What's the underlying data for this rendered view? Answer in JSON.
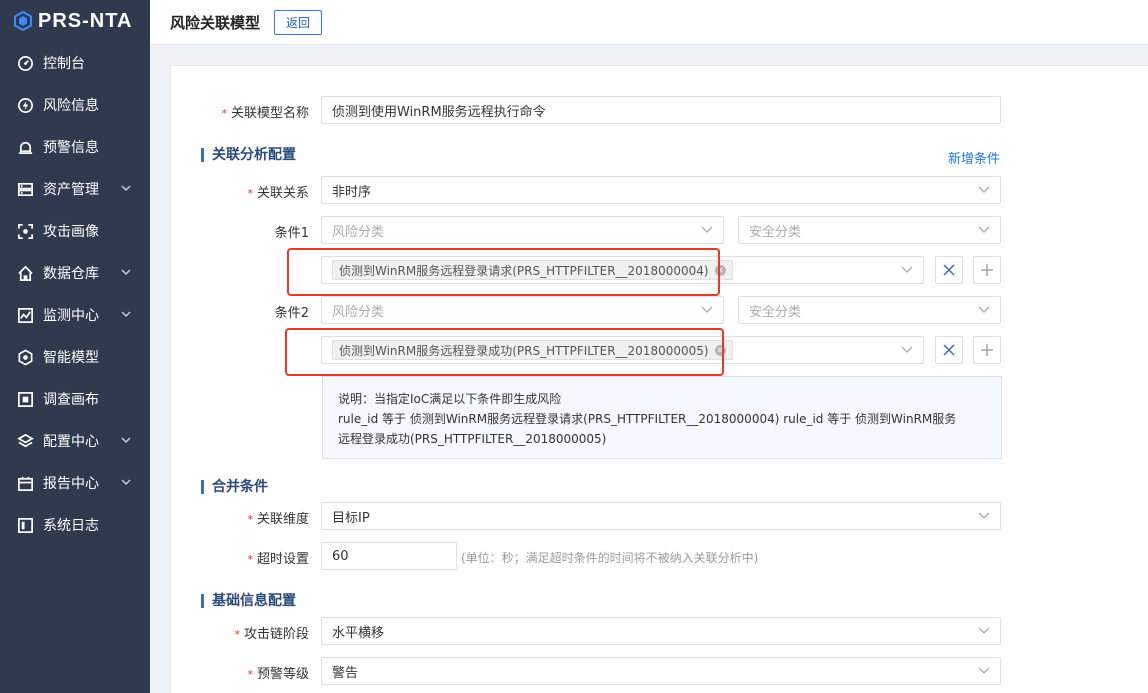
{
  "app": {
    "logo_text": "PRS-NTA"
  },
  "sidebar": {
    "items": [
      {
        "label": "控制台",
        "icon": "dashboard-icon",
        "chevron": false
      },
      {
        "label": "风险信息",
        "icon": "bolt-icon",
        "chevron": false
      },
      {
        "label": "预警信息",
        "icon": "alarm-icon",
        "chevron": false
      },
      {
        "label": "资产管理",
        "icon": "server-icon",
        "chevron": true
      },
      {
        "label": "攻击画像",
        "icon": "target-icon",
        "chevron": false
      },
      {
        "label": "数据仓库",
        "icon": "home-icon",
        "chevron": true
      },
      {
        "label": "监测中心",
        "icon": "monitor-icon",
        "chevron": true
      },
      {
        "label": "智能模型",
        "icon": "hexagon-icon",
        "chevron": false
      },
      {
        "label": "调查画布",
        "icon": "canvas-icon",
        "chevron": false
      },
      {
        "label": "配置中心",
        "icon": "layers-icon",
        "chevron": true
      },
      {
        "label": "报告中心",
        "icon": "calendar-icon",
        "chevron": true
      },
      {
        "label": "系统日志",
        "icon": "log-icon",
        "chevron": false
      }
    ]
  },
  "header": {
    "title": "风险关联模型",
    "back_label": "返回"
  },
  "form": {
    "model_name_label": "关联模型名称",
    "model_name_value": "侦测到使用WinRM服务远程执行命令",
    "section_analysis": "关联分析配置",
    "add_condition": "新增条件",
    "relation_label": "关联关系",
    "relation_value": "非时序",
    "conditions": [
      {
        "label": "条件1",
        "risk_placeholder": "风险分类",
        "security_placeholder": "安全分类",
        "tag": "侦测到WinRM服务远程登录请求(PRS_HTTPFILTER__2018000004)"
      },
      {
        "label": "条件2",
        "risk_placeholder": "风险分类",
        "security_placeholder": "安全分类",
        "tag": "侦测到WinRM服务远程登录成功(PRS_HTTPFILTER__2018000005)"
      }
    ],
    "note_line1": "说明：当指定IoC满足以下条件即生成风险",
    "note_line2": "rule_id 等于 侦测到WinRM服务远程登录请求(PRS_HTTPFILTER__2018000004) rule_id 等于 侦测到WinRM服务",
    "note_line3": "远程登录成功(PRS_HTTPFILTER__2018000005)",
    "section_merge": "合并条件",
    "dimension_label": "关联维度",
    "dimension_value": "目标IP",
    "timeout_label": "超时设置",
    "timeout_value": "60",
    "timeout_hint": "(单位：秒；满足超时条件的时间将不被纳入关联分析中)",
    "section_basic": "基础信息配置",
    "killchain_label": "攻击链阶段",
    "killchain_value": "水平横移",
    "level_label": "预警等级",
    "level_value": "警告"
  },
  "colors": {
    "sidebar_bg": "#2f3a4f",
    "accent": "#1e78d7",
    "highlight": "#e53a2a"
  }
}
